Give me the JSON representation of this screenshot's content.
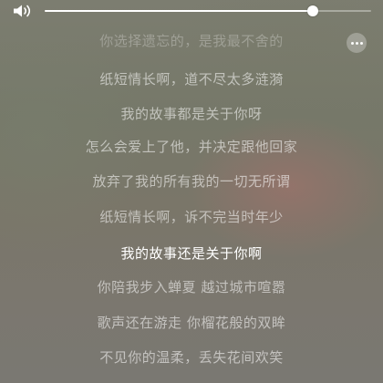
{
  "player": {
    "volume_icon": "speaker-icon",
    "volume_level": 0.82,
    "more_icon": "ellipsis-icon"
  },
  "lyrics": {
    "current_index": 6,
    "lines": [
      "你选择遗忘的，是我最不舍的",
      "纸短情长啊，道不尽太多涟漪",
      "我的故事都是关于你呀",
      "怎么会爱上了他，并决定跟他回家",
      "放弃了我的所有我的一切无所谓",
      "纸短情长啊，诉不完当时年少",
      "我的故事还是关于你啊",
      "你陪我步入蝉夏 越过城市喧嚣",
      "歌声还在游走 你榴花般的双眸",
      "不见你的温柔，丢失花间欢笑"
    ]
  }
}
